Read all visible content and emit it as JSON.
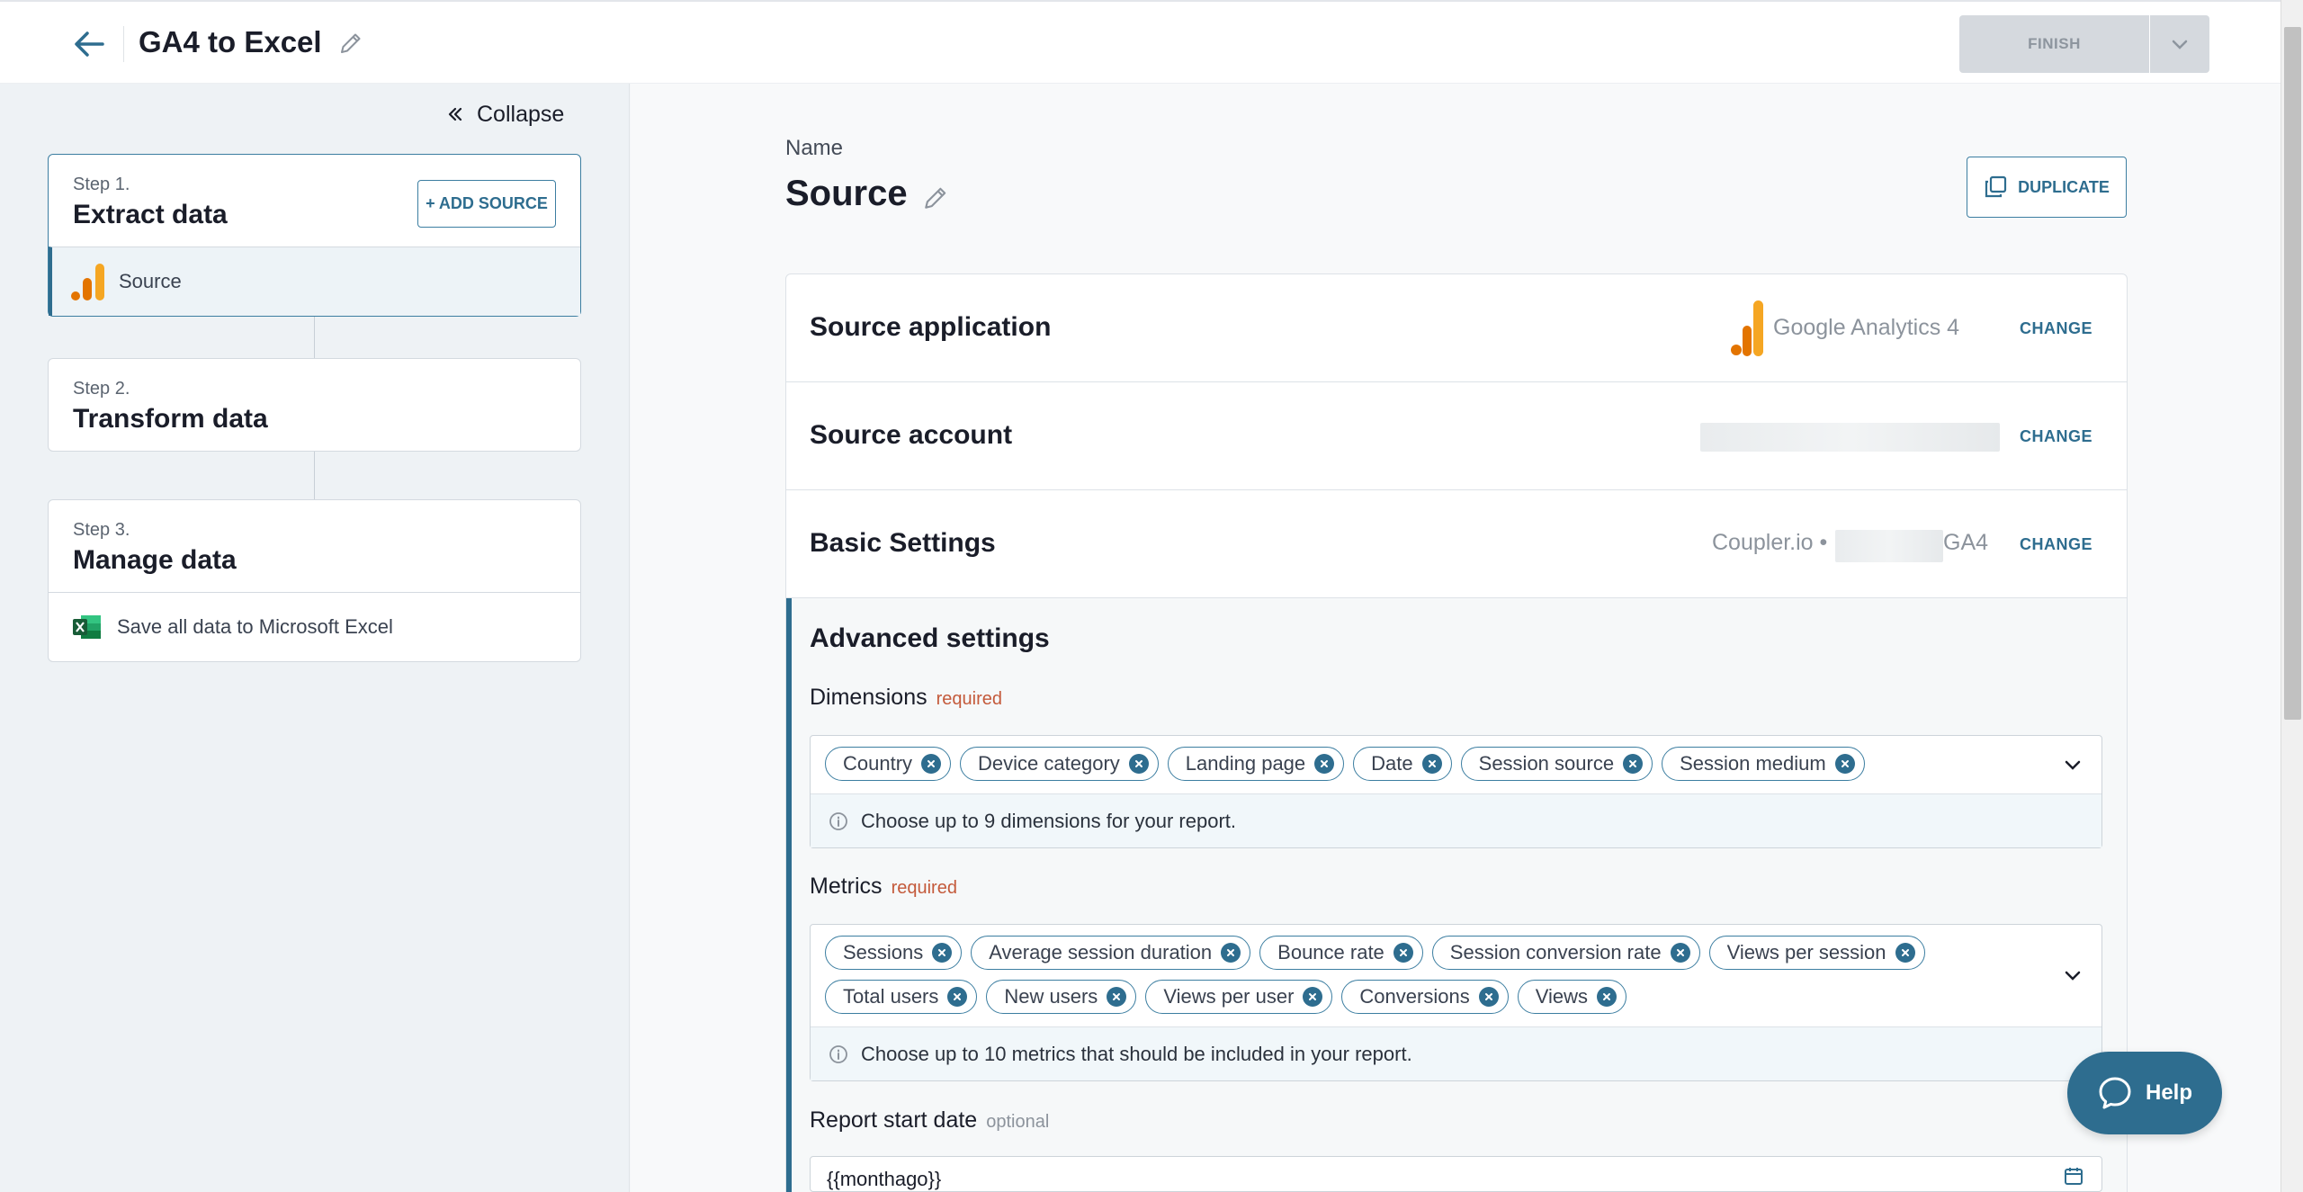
{
  "header": {
    "title": "GA4 to Excel",
    "finish_label": "FINISH"
  },
  "sidebar": {
    "collapse_label": "Collapse",
    "steps": [
      {
        "label": "Step 1.",
        "title": "Extract data",
        "action": "+ ADD SOURCE",
        "item": "Source"
      },
      {
        "label": "Step 2.",
        "title": "Transform data"
      },
      {
        "label": "Step 3.",
        "title": "Manage data",
        "item": "Save all data to Microsoft Excel"
      }
    ]
  },
  "main": {
    "name_label": "Name",
    "source_title": "Source",
    "duplicate_label": "DUPLICATE",
    "rows": {
      "application": {
        "title": "Source application",
        "value": "Google Analytics 4",
        "change": "CHANGE"
      },
      "account": {
        "title": "Source account",
        "change": "CHANGE"
      },
      "basic": {
        "title": "Basic Settings",
        "value_prefix": "Coupler.io •",
        "value_suffix": "GA4",
        "change": "CHANGE"
      }
    },
    "advanced": {
      "title": "Advanced settings",
      "dimensions": {
        "label": "Dimensions",
        "tag": "required",
        "chips": [
          "Country",
          "Device category",
          "Landing page",
          "Date",
          "Session source",
          "Session medium"
        ],
        "hint": "Choose up to 9 dimensions for your report."
      },
      "metrics": {
        "label": "Metrics",
        "tag": "required",
        "chips_row1": [
          "Sessions",
          "Average session duration",
          "Bounce rate",
          "Session conversion rate",
          "Views per session"
        ],
        "chips_row2": [
          "Total users",
          "New users",
          "Views per user",
          "Conversions",
          "Views"
        ],
        "hint": "Choose up to 10 metrics that should be included in your report."
      },
      "start_date": {
        "label": "Report start date",
        "tag": "optional",
        "value": "{{monthago}}"
      }
    }
  },
  "help": {
    "label": "Help"
  },
  "colors": {
    "accent": "#2e6d8f",
    "required": "#c45a3b",
    "ga_orange": "#f5a623",
    "ga_dark": "#e37400"
  }
}
